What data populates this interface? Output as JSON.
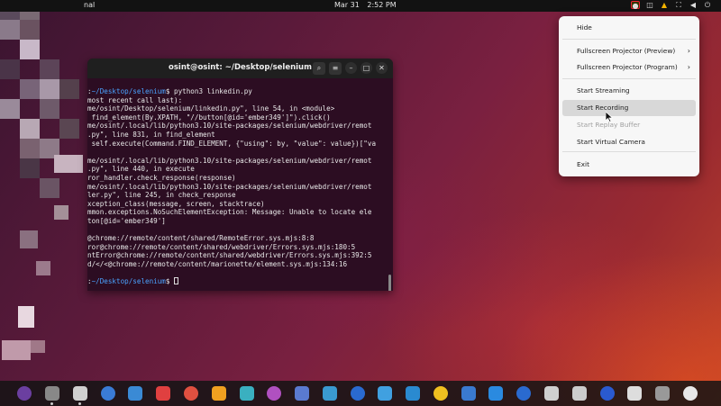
{
  "topbar": {
    "app_name": "nal",
    "date": "Mar 31",
    "time": "2:52 PM"
  },
  "terminal": {
    "title": "osint@osint: ~/Desktop/selenium",
    "lines": [
      ":~/Desktop/selenium$ python3 linkedin.py",
      "most recent call last):",
      "me/osint/Desktop/selenium/linkedin.py\", line 54, in <module>",
      " find_element(By.XPATH, \"//button[@id='ember349']\").click()",
      "me/osint/.local/lib/python3.10/site-packages/selenium/webdriver/remot",
      ".py\", line 831, in find_element",
      " self.execute(Command.FIND_ELEMENT, {\"using\": by, \"value\": value})[\"va",
      "",
      "me/osint/.local/lib/python3.10/site-packages/selenium/webdriver/remot",
      ".py\", line 440, in execute",
      "ror_handler.check_response(response)",
      "me/osint/.local/lib/python3.10/site-packages/selenium/webdriver/remot",
      "ler.py\", line 245, in check_response",
      "xception_class(message, screen, stacktrace)",
      "mmon.exceptions.NoSuchElementException: Message: Unable to locate ele",
      "ton[@id='ember349']",
      "",
      "@chrome://remote/content/shared/RemoteError.sys.mjs:8:8",
      "ror@chrome://remote/content/shared/webdriver/Errors.sys.mjs:180:5",
      "ntError@chrome://remote/content/shared/webdriver/Errors.sys.mjs:392:5",
      "d/</<@chrome://remote/content/marionette/element.sys.mjs:134:16",
      "",
      ":~/Desktop/selenium$ "
    ],
    "prompt_path_text": "~/Desktop/selenium"
  },
  "menu": {
    "items": [
      {
        "label": "Hide",
        "state": "normal"
      },
      {
        "label": "Fullscreen Projector (Preview)",
        "state": "submenu"
      },
      {
        "label": "Fullscreen Projector (Program)",
        "state": "submenu"
      },
      {
        "label": "Start Streaming",
        "state": "normal"
      },
      {
        "label": "Start Recording",
        "state": "highlighted"
      },
      {
        "label": "Start Replay Buffer",
        "state": "disabled"
      },
      {
        "label": "Start Virtual Camera",
        "state": "normal"
      },
      {
        "label": "Exit",
        "state": "normal"
      }
    ],
    "submenu_arrow": "›"
  },
  "icons": {
    "search": "search-icon",
    "hamburger": "menu-icon",
    "minimize": "minimize-icon",
    "maximize": "maximize-icon",
    "close": "close-icon"
  },
  "colors": {
    "terminal_bg": "#2c0d22",
    "prompt_path": "#4aa3ff",
    "menu_bg": "#f7f7f7",
    "highlight": "#d8d8d8"
  },
  "dock": {
    "apps": [
      "terminal-icon",
      "obs-icon",
      "files-icon",
      "firefox-icon",
      "media-icon",
      "screenshot-icon",
      "notes-icon",
      "store-icon",
      "camera-icon",
      "contacts-icon",
      "people-icon",
      "calendar-icon",
      "globe-icon",
      "layers-icon",
      "lamp-icon",
      "tools-icon",
      "settings-icon",
      "text-icon",
      "display-icon",
      "disk-icon",
      "bookmark-icon",
      "gear-icon",
      "clock-icon",
      "edit-icon",
      "grid-icon"
    ]
  }
}
